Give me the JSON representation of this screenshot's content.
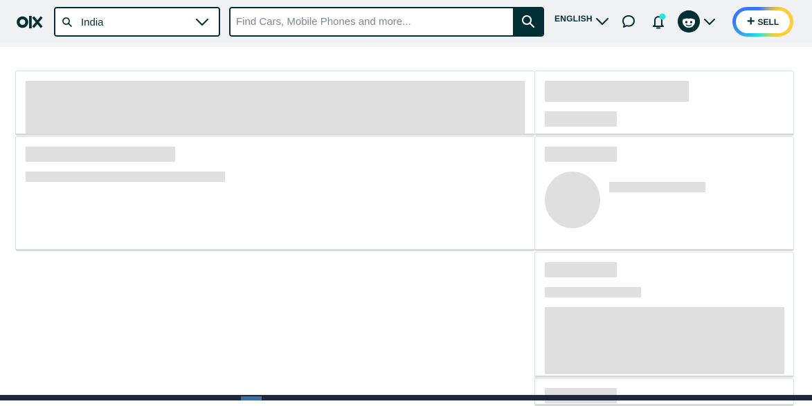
{
  "header": {
    "logo_text": "olx",
    "location": {
      "value": "India"
    },
    "search": {
      "placeholder": "Find Cars, Mobile Phones and more..."
    },
    "language_label": "ENGLISH",
    "sell_label": "SELL",
    "icons": {
      "location": "search-icon",
      "search": "search-icon",
      "chat": "chat-icon",
      "notifications": "bell-icon",
      "dropdown": "chevron-down-icon"
    },
    "colors": {
      "brand_dark": "#002f34",
      "header_bg": "#eff1f3",
      "notification_dot": "#23e5db",
      "sell_ring": [
        "#23e5db",
        "#3a77ff",
        "#ffce32"
      ]
    }
  },
  "main": {
    "state": "loading",
    "skeleton_color": "#dfdfdf"
  }
}
